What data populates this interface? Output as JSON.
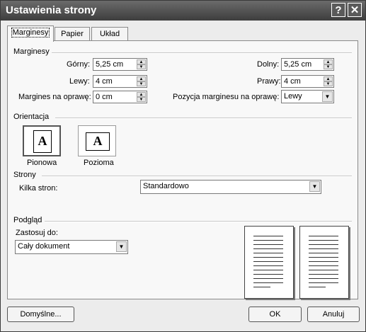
{
  "dialog": {
    "title": "Ustawienia strony",
    "help_button": "?",
    "close_button": "✕"
  },
  "tabs": [
    {
      "label": "Marginesy",
      "active": true
    },
    {
      "label": "Papier",
      "active": false
    },
    {
      "label": "Układ",
      "active": false
    }
  ],
  "margins": {
    "group_label": "Marginesy",
    "top": {
      "label": "Górny:",
      "value": "5,25 cm"
    },
    "left": {
      "label": "Lewy:",
      "value": "4 cm"
    },
    "gutter": {
      "label": "Margines na oprawę:",
      "value": "0 cm"
    },
    "bottom": {
      "label": "Dolny:",
      "value": "5,25 cm"
    },
    "right": {
      "label": "Prawy:",
      "value": "4 cm"
    },
    "gutter_position": {
      "label": "Pozycja marginesu na oprawę:",
      "value": "Lewy"
    }
  },
  "orientation": {
    "group_label": "Orientacja",
    "portrait": {
      "label": "Pionowa",
      "glyph": "A",
      "selected": true
    },
    "landscape": {
      "label": "Pozioma",
      "glyph": "A",
      "selected": false
    }
  },
  "pages": {
    "group_label": "Strony",
    "multiple_label": "Kilka stron:",
    "multiple_value": "Standardowo"
  },
  "preview": {
    "group_label": "Podgląd",
    "apply_label": "Zastosuj do:",
    "apply_value": "Cały dokument"
  },
  "footer": {
    "default_button": "Domyślne...",
    "ok_button": "OK",
    "cancel_button": "Anuluj"
  },
  "icons": {
    "spin_up": "▲",
    "spin_down": "▼",
    "dropdown": "▼"
  }
}
